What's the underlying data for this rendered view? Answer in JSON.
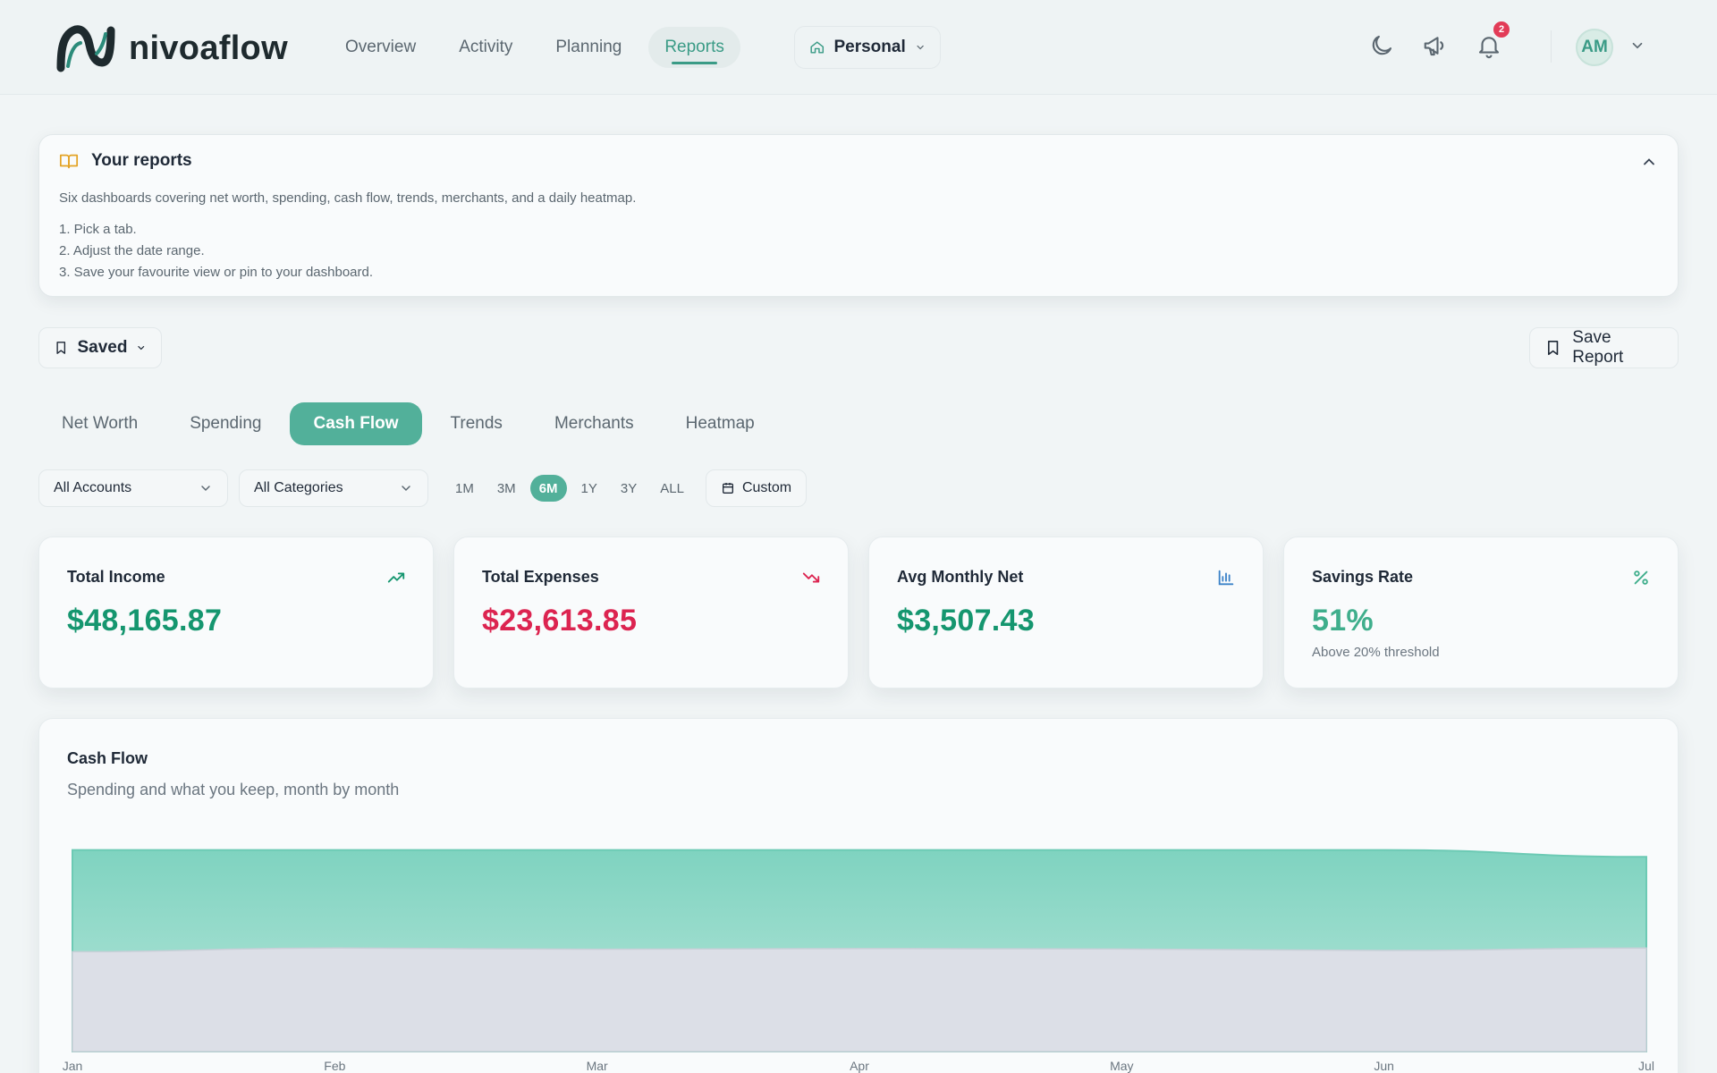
{
  "header": {
    "brand": "nivoaflow",
    "nav": [
      {
        "label": "Overview",
        "active": false
      },
      {
        "label": "Activity",
        "active": false
      },
      {
        "label": "Planning",
        "active": false
      },
      {
        "label": "Reports",
        "active": true
      }
    ],
    "workspace": "Personal",
    "notification_count": "2",
    "avatar_initials": "AM"
  },
  "info": {
    "title": "Your reports",
    "description": "Six dashboards covering net worth, spending, cash flow, trends, merchants, and a daily heatmap.",
    "steps": [
      "1. Pick a tab.",
      "2. Adjust the date range.",
      "3. Save your favourite view or pin to your dashboard."
    ]
  },
  "toolbar": {
    "saved_label": "Saved",
    "save_report_label": "Save Report"
  },
  "tabs": [
    {
      "label": "Net Worth",
      "active": false
    },
    {
      "label": "Spending",
      "active": false
    },
    {
      "label": "Cash Flow",
      "active": true
    },
    {
      "label": "Trends",
      "active": false
    },
    {
      "label": "Merchants",
      "active": false
    },
    {
      "label": "Heatmap",
      "active": false
    }
  ],
  "filters": {
    "accounts": "All Accounts",
    "categories": "All Categories",
    "ranges": [
      {
        "label": "1M",
        "active": false
      },
      {
        "label": "3M",
        "active": false
      },
      {
        "label": "6M",
        "active": true
      },
      {
        "label": "1Y",
        "active": false
      },
      {
        "label": "3Y",
        "active": false
      },
      {
        "label": "ALL",
        "active": false
      }
    ],
    "custom_label": "Custom"
  },
  "kpis": [
    {
      "label": "Total Income",
      "value": "$48,165.87",
      "icon": "trending-up-icon",
      "color": "#15966f",
      "sub": ""
    },
    {
      "label": "Total Expenses",
      "value": "$23,613.85",
      "icon": "trending-down-icon",
      "color": "#dc2450",
      "sub": ""
    },
    {
      "label": "Avg Monthly Net",
      "value": "$3,507.43",
      "icon": "bar-chart-icon",
      "color": "#15966f",
      "sub": ""
    },
    {
      "label": "Savings Rate",
      "value": "51%",
      "icon": "percent-icon",
      "color": "#3fae8c",
      "sub": "Above 20% threshold"
    }
  ],
  "colors": {
    "accent": "#52b09a",
    "income_green": "#15966f",
    "expense_red": "#dc2450",
    "income_area": "#7fd3c0",
    "expense_area": "#dcdfe7"
  },
  "chart_data": {
    "type": "area",
    "title": "Cash Flow",
    "subtitle": "Spending and what you keep, month by month",
    "categories": [
      "Jan",
      "Feb",
      "Mar",
      "Apr",
      "May",
      "Jun",
      "Jul"
    ],
    "ylim": [
      0,
      9000
    ],
    "grid": false,
    "series": [
      {
        "name": "",
        "values": [
          8180,
          8180,
          8180,
          8180,
          8180,
          8180,
          7900
        ],
        "color": "#7fd3c0"
      },
      {
        "name": "",
        "values": [
          4050,
          4200,
          4150,
          4180,
          4160,
          4100,
          4200
        ],
        "color": "#dcdfe7"
      }
    ]
  }
}
